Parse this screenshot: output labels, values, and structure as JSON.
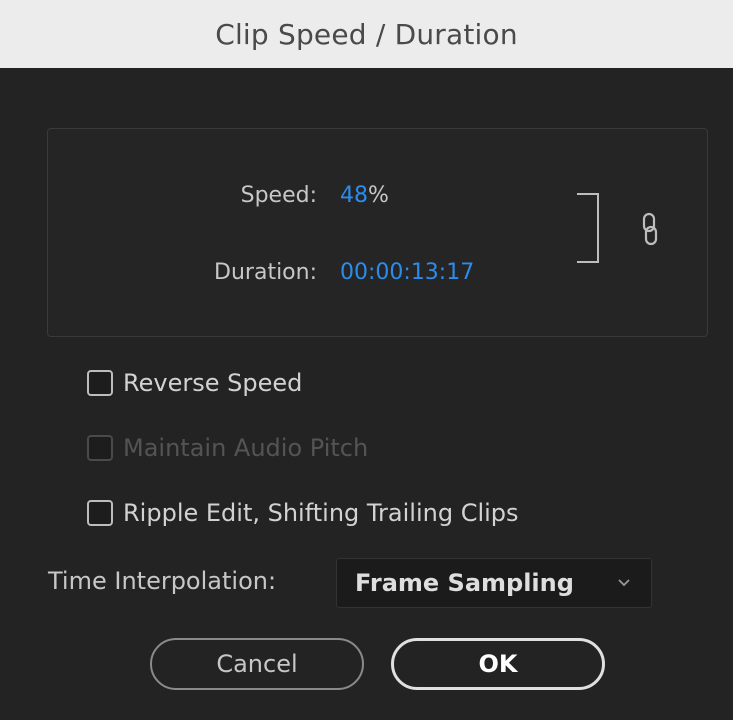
{
  "window": {
    "title": "Clip Speed / Duration"
  },
  "speed": {
    "label": "Speed:",
    "value": "48",
    "unit": "%"
  },
  "duration": {
    "label": "Duration:",
    "value": "00:00:13:17"
  },
  "link_icon": {
    "icon": "link-icon",
    "state": "linked"
  },
  "options": {
    "reverse_speed": {
      "label": "Reverse Speed",
      "checked": false,
      "enabled": true
    },
    "maintain_audio_pitch": {
      "label": "Maintain Audio Pitch",
      "checked": false,
      "enabled": false
    },
    "ripple_edit": {
      "label": "Ripple Edit, Shifting Trailing Clips",
      "checked": false,
      "enabled": true
    }
  },
  "time_interpolation": {
    "label": "Time Interpolation:",
    "selected": "Frame Sampling"
  },
  "buttons": {
    "cancel_label": "Cancel",
    "ok_label": "OK"
  },
  "colors": {
    "accent_value": "#2d8ceb",
    "background": "#232323",
    "titlebar": "#ececec"
  }
}
